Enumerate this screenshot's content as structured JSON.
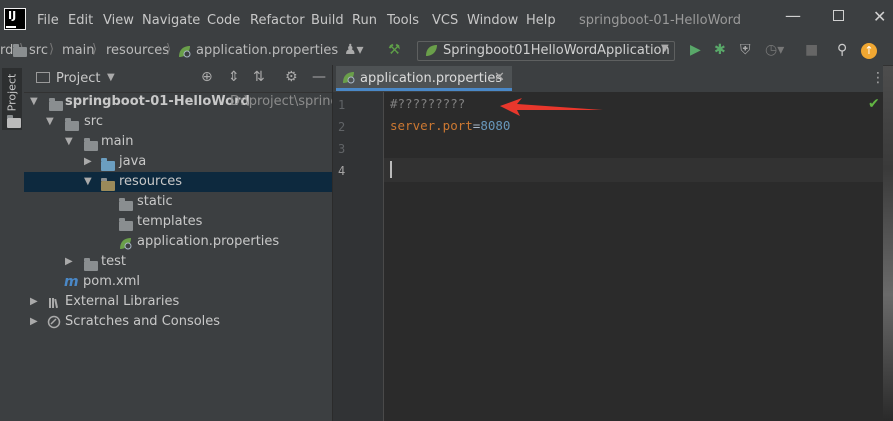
{
  "menu": {
    "logo_label": "IJ",
    "items": [
      "File",
      "Edit",
      "View",
      "Navigate",
      "Code",
      "Refactor",
      "Build",
      "Run",
      "Tools",
      "VCS",
      "Window",
      "Help"
    ],
    "window_title": "springboot-01-HelloWord"
  },
  "breadcrumb": {
    "items": [
      "rd",
      "src",
      "main",
      "resources",
      "application.properties"
    ]
  },
  "run_config": {
    "name": "Springboot01HelloWordApplication"
  },
  "project_panel": {
    "vertical_tab": "Project",
    "title": "Project",
    "tree": [
      {
        "label": "springboot-01-HelloWord",
        "path": "D:\\project\\springb",
        "depth": 0,
        "arrow": "expanded",
        "icon": "folder-module"
      },
      {
        "label": "src",
        "depth": 1,
        "arrow": "expanded",
        "icon": "folder"
      },
      {
        "label": "main",
        "depth": 2,
        "arrow": "expanded",
        "icon": "folder"
      },
      {
        "label": "java",
        "depth": 3,
        "arrow": "collapsed",
        "icon": "folder-blue"
      },
      {
        "label": "resources",
        "depth": 3,
        "arrow": "expanded",
        "icon": "folder-resources",
        "selected": true
      },
      {
        "label": "static",
        "depth": 4,
        "arrow": "none",
        "icon": "folder"
      },
      {
        "label": "templates",
        "depth": 4,
        "arrow": "none",
        "icon": "folder"
      },
      {
        "label": "application.properties",
        "depth": 4,
        "arrow": "none",
        "icon": "spring-leaf"
      },
      {
        "label": "test",
        "depth": 2,
        "arrow": "collapsed",
        "icon": "folder"
      },
      {
        "label": "pom.xml",
        "depth": 1,
        "arrow": "none",
        "icon": "maven"
      },
      {
        "label": "External Libraries",
        "depth": 0,
        "arrow": "collapsed",
        "icon": "libraries"
      },
      {
        "label": "Scratches and Consoles",
        "depth": 0,
        "arrow": "collapsed",
        "icon": "scratches"
      }
    ]
  },
  "editor": {
    "tab_label": "application.properties",
    "line_numbers": [
      "1",
      "2",
      "3",
      "4"
    ],
    "lines": {
      "comment": "#?????????",
      "key": "server.port",
      "eq": "=",
      "value": "8080"
    }
  },
  "colors": {
    "accent": "#4a88c7",
    "selection": "#0d293e",
    "comment": "#808080",
    "key": "#cc7832",
    "number": "#6897bb",
    "annotation_arrow": "#e8372c",
    "check": "#62b543"
  }
}
